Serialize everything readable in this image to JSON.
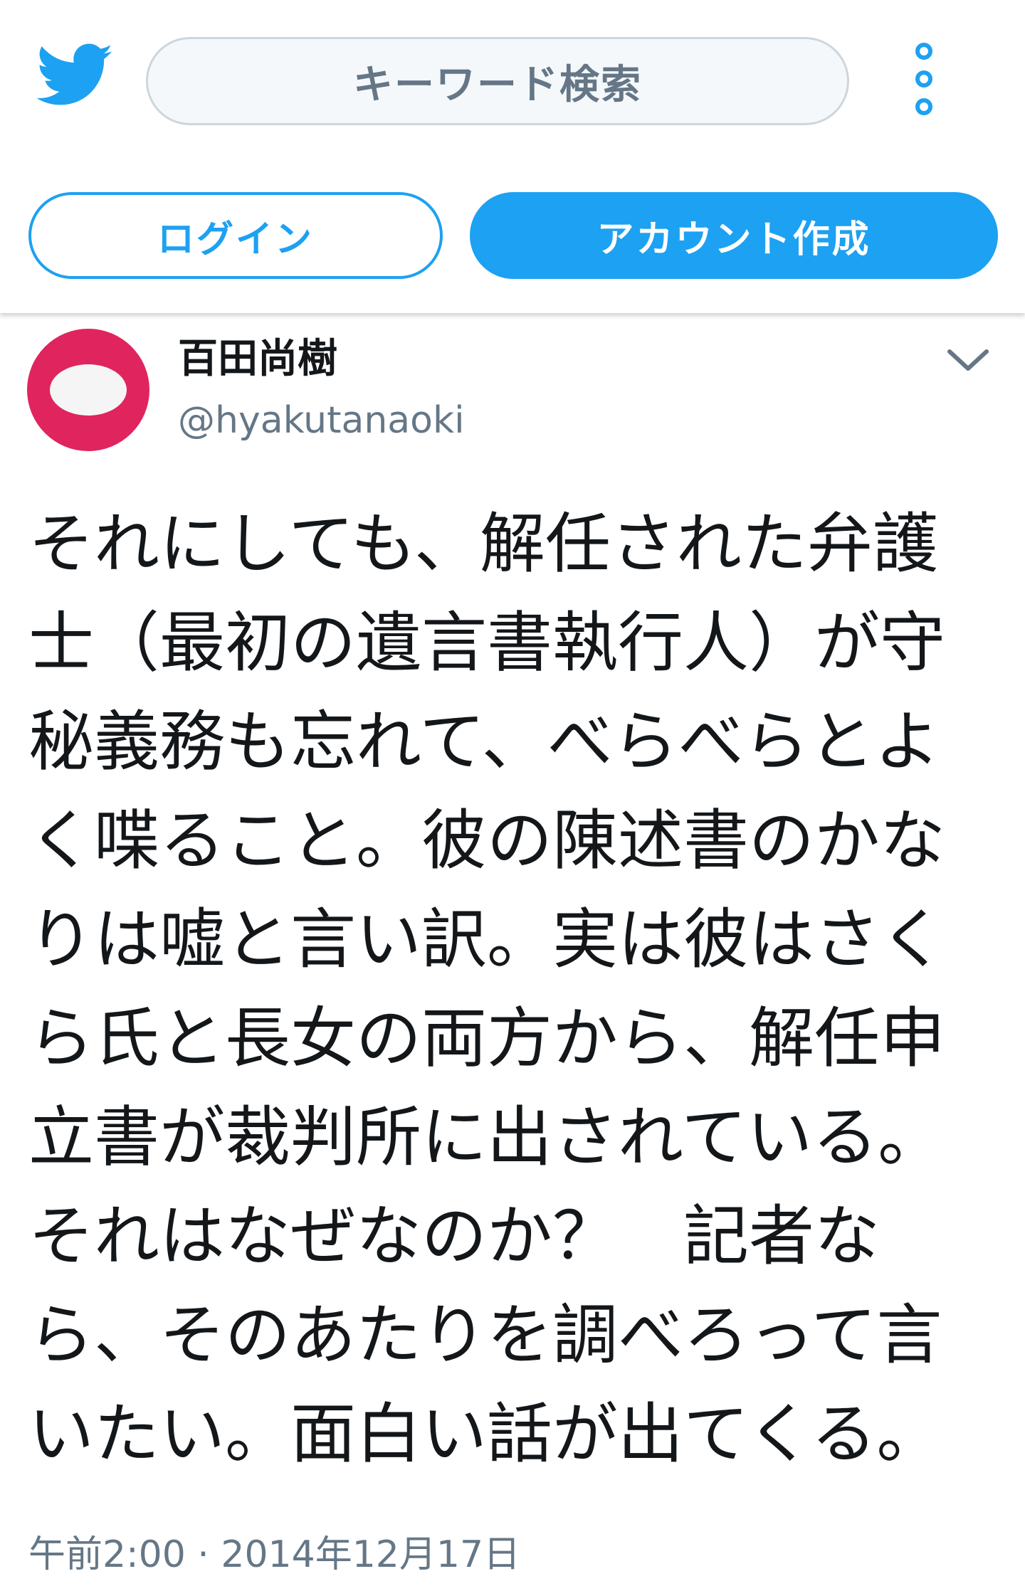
{
  "header": {
    "logo_icon": "twitter-bird-icon",
    "search_placeholder": "キーワード検索",
    "more_icon": "more-vertical-icon",
    "login_label": "ログイン",
    "signup_label": "アカウント作成",
    "accent_color": "#1da1f2"
  },
  "tweet": {
    "author_name": "百田尚樹",
    "author_handle": "@hyakutanaoki",
    "menu_icon": "chevron-down-icon",
    "text": "それにしても、解任された弁護\n士（最初の遺言書執行人）が守\n秘義務も忘れて、べらべらとよ\nく喋ること。彼の陳述書のかな\nりは嘘と言い訳。実は彼はさく\nら氏と長女の両方から、解任申\n立書が裁判所に出されている。\nそれはなぜなのか？　記者な\nら、そのあたりを調べろって言\nいたい。面白い話が出てくる。",
    "timestamp": "午前2:00 · 2014年12月17日"
  }
}
